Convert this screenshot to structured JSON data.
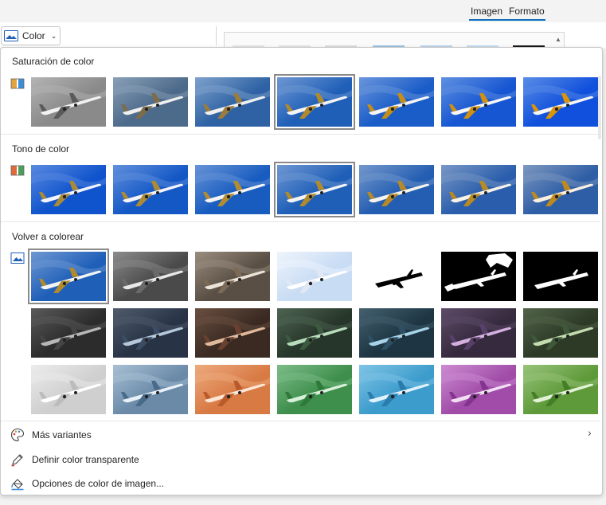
{
  "ribbon": {
    "tabs": [
      "Imagen",
      "Formato"
    ],
    "color_button_label": "Color",
    "color_button_icon": "image-icon",
    "chevron_icon": "chevron-down-icon"
  },
  "panel": {
    "sections": [
      {
        "title": "Saturación de color",
        "icon": "color-swatch-icon"
      },
      {
        "title": "Tono de color",
        "icon": "color-swatch-icon"
      },
      {
        "title": "Volver a colorear",
        "icon": "image-icon"
      }
    ],
    "menu_items": [
      {
        "label": "Más variantes",
        "icon": "palette-icon",
        "has_submenu": true
      },
      {
        "label": "Definir color transparente",
        "icon": "pen-icon",
        "has_submenu": false
      },
      {
        "label": "Opciones de color de imagen...",
        "icon": "paint-bucket-icon",
        "has_submenu": false
      }
    ]
  },
  "gallery": {
    "saturation": {
      "selected_index": 3,
      "swatches": [
        {
          "sky": "#8a8a8a",
          "sky2": "#b4b4b4",
          "plane": "#f2f2f2",
          "tail": "#5a5a5a"
        },
        {
          "sky": "#4c6a8a",
          "sky2": "#8aa0b8",
          "plane": "#f0f0f0",
          "tail": "#7c6c4c"
        },
        {
          "sky": "#2e62a4",
          "sky2": "#7fa2cc",
          "plane": "#f0f0f0",
          "tail": "#9c7c3c"
        },
        {
          "sky": "#1f5fb8",
          "sky2": "#6f98d2",
          "plane": "#f4f4f4",
          "tail": "#b08a2c"
        },
        {
          "sky": "#1a5cc8",
          "sky2": "#6a96dc",
          "plane": "#f4f4f4",
          "tail": "#c48e18"
        },
        {
          "sky": "#1656d2",
          "sky2": "#6090e0",
          "plane": "#f6f6f6",
          "tail": "#d09010"
        },
        {
          "sky": "#1050dc",
          "sky2": "#5a8ce6",
          "plane": "#f6f6f6",
          "tail": "#dc9408"
        }
      ]
    },
    "tone": {
      "selected_index": 3,
      "swatches": [
        {
          "sky": "#0f54cc",
          "sky2": "#5b8ae0",
          "plane": "#f2f4ff",
          "tail": "#a88a3a"
        },
        {
          "sky": "#1458c6",
          "sky2": "#6290dc",
          "plane": "#f4f4fa",
          "tail": "#ae8a34"
        },
        {
          "sky": "#185cc0",
          "sky2": "#6894d6",
          "plane": "#f4f4f4",
          "tail": "#b28c30"
        },
        {
          "sky": "#1f5fb8",
          "sky2": "#6f98d2",
          "plane": "#f4f4f4",
          "tail": "#b08a2c"
        },
        {
          "sky": "#245eb2",
          "sky2": "#7498cc",
          "plane": "#f6f4ee",
          "tail": "#b68a28"
        },
        {
          "sky": "#2a5eac",
          "sky2": "#7a98c6",
          "plane": "#f8f2e8",
          "tail": "#ba8a22"
        },
        {
          "sky": "#2e5ea6",
          "sky2": "#7e98c0",
          "plane": "#faf0e2",
          "tail": "#be8a1e"
        }
      ]
    },
    "recolor": {
      "selected_index": 0,
      "rows": [
        [
          {
            "sky": "#1f5fb8",
            "sky2": "#6f98d2",
            "plane": "#f4f4f4",
            "tail": "#b08a2c"
          },
          {
            "sky": "#4a4a4a",
            "sky2": "#8c8c8c",
            "plane": "#e8e8e8",
            "tail": "#6a6a6a"
          },
          {
            "sky": "#5a4f44",
            "sky2": "#9a8e80",
            "plane": "#ece4d8",
            "tail": "#7a6a56"
          },
          {
            "sky": "#c8dcf4",
            "sky2": "#eef4fc",
            "plane": "#ffffff",
            "tail": "#e0e8f4"
          },
          {
            "sky": "#ffffff",
            "sky2": "#ffffff",
            "plane": "#000000",
            "tail": "#000000",
            "mode": "bw-white"
          },
          {
            "sky": "#000000",
            "sky2": "#000000",
            "plane": "#ffffff",
            "tail": "#ffffff",
            "mode": "bw-black"
          },
          {
            "sky": "#000000",
            "sky2": "#000000",
            "plane": "#ffffff",
            "tail": "#000000",
            "mode": "bw-black2"
          }
        ],
        [
          {
            "sky": "#2c2c2c",
            "sky2": "#5a5a5a",
            "plane": "#b8b8b8",
            "tail": "#444444"
          },
          {
            "sky": "#283446",
            "sky2": "#505c6c",
            "plane": "#b6c8dc",
            "tail": "#3c4c62"
          },
          {
            "sky": "#3a2a22",
            "sky2": "#6a5040",
            "plane": "#e0b89a",
            "tail": "#6a4030"
          },
          {
            "sky": "#26362a",
            "sky2": "#4e6452",
            "plane": "#b8dcbc",
            "tail": "#3c5a40"
          },
          {
            "sky": "#1e3644",
            "sky2": "#44606e",
            "plane": "#a8d4ea",
            "tail": "#2e5064"
          },
          {
            "sky": "#362a3e",
            "sky2": "#5e4c68",
            "plane": "#d4b0e0",
            "tail": "#58406a"
          },
          {
            "sky": "#2c3a26",
            "sky2": "#52644a",
            "plane": "#c4dcb0",
            "tail": "#40583a"
          }
        ],
        [
          {
            "sky": "#cfcfcf",
            "sky2": "#ececec",
            "plane": "#ffffff",
            "tail": "#bcbcbc"
          },
          {
            "sky": "#6a8aa8",
            "sky2": "#a8c0d4",
            "plane": "#e8f0f8",
            "tail": "#4a6a8a"
          },
          {
            "sky": "#d87a44",
            "sky2": "#eeaa7e",
            "plane": "#fde6d6",
            "tail": "#b85a2a"
          },
          {
            "sky": "#3e8e4c",
            "sky2": "#7cbc88",
            "plane": "#d6f0da",
            "tail": "#2e7a3a"
          },
          {
            "sky": "#3c9ccc",
            "sky2": "#80c4e6",
            "plane": "#e0f2fc",
            "tail": "#2a7cac"
          },
          {
            "sky": "#a04ca8",
            "sky2": "#cc8cd2",
            "plane": "#f2def4",
            "tail": "#84348e"
          },
          {
            "sky": "#5e9a3a",
            "sky2": "#98c47a",
            "plane": "#e2f2d6",
            "tail": "#467e28"
          }
        ]
      ]
    }
  }
}
